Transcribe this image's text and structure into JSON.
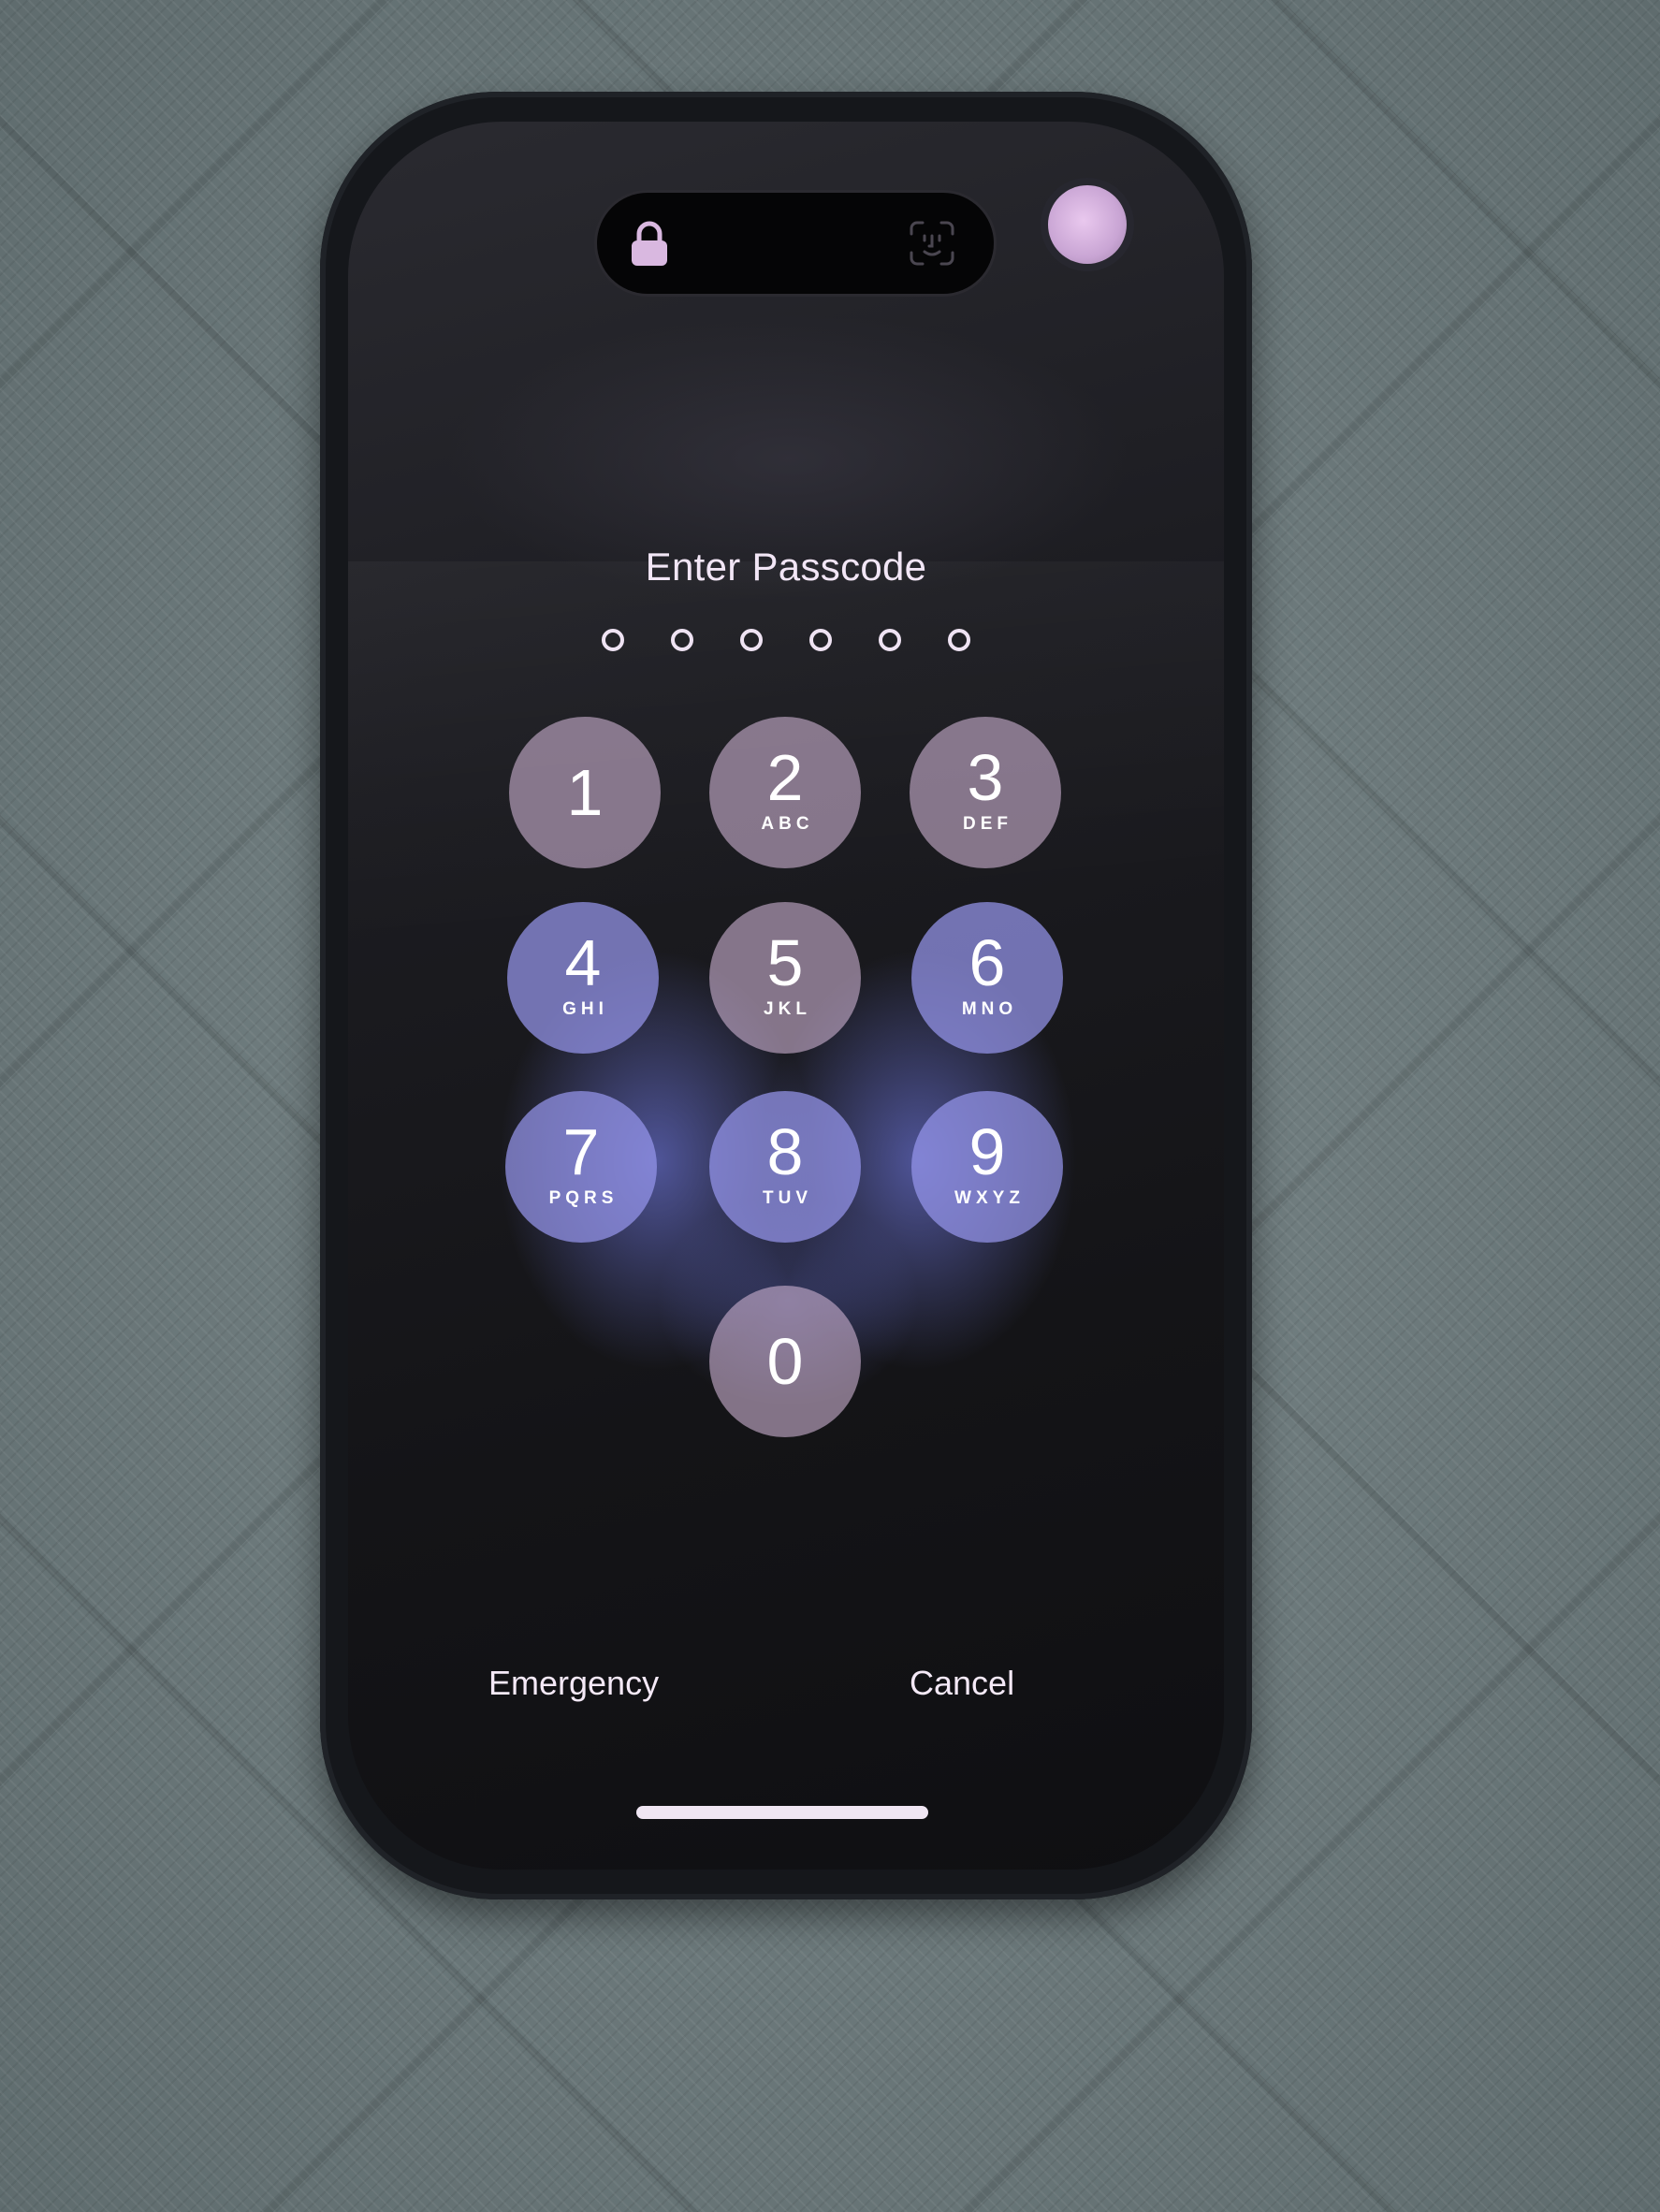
{
  "lock_screen": {
    "title": "Enter Passcode",
    "passcode_length": 6,
    "entered_digits": 0,
    "keys": [
      {
        "digit": "1",
        "letters": ""
      },
      {
        "digit": "2",
        "letters": "ABC"
      },
      {
        "digit": "3",
        "letters": "DEF"
      },
      {
        "digit": "4",
        "letters": "GHI"
      },
      {
        "digit": "5",
        "letters": "JKL"
      },
      {
        "digit": "6",
        "letters": "MNO"
      },
      {
        "digit": "7",
        "letters": "PQRS"
      },
      {
        "digit": "8",
        "letters": "TUV"
      },
      {
        "digit": "9",
        "letters": "WXYZ"
      },
      {
        "digit": "0",
        "letters": ""
      }
    ],
    "emergency_label": "Emergency",
    "cancel_label": "Cancel"
  },
  "status": {
    "left_icon": "lock-icon",
    "right_icon": "face-id-icon"
  },
  "colors": {
    "key_fill": "#c8afcd",
    "key_glow": "#9696eb",
    "text": "#f2e6f6",
    "accent": "#c9a5d4"
  }
}
